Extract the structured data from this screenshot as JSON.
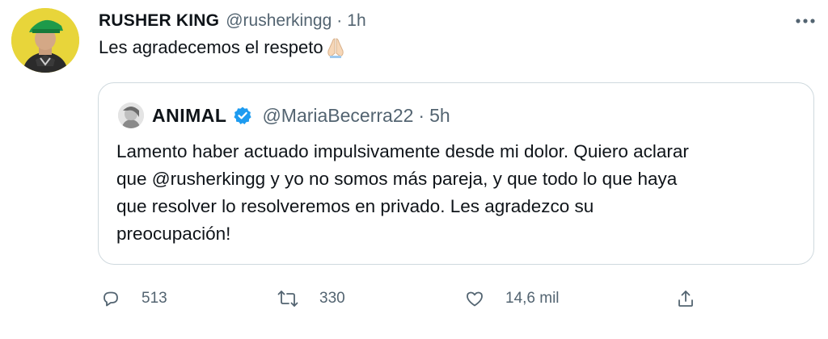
{
  "author": {
    "name": "RUSHER KING",
    "handle": "@rusherkingg",
    "separator": "·",
    "time": "1h"
  },
  "tweet": {
    "text": "Les agradecemos el respeto",
    "emoji": "folded-hands-emoji"
  },
  "quoted": {
    "name": "ANIMAL",
    "verified": true,
    "handle": "@MariaBecerra22",
    "separator": "·",
    "time": "5h",
    "lines": [
      "Lamento haber actuado impulsivamente desde mi dolor. Quiero aclarar",
      "que @rusherkingg y yo no somos más pareja, y que todo lo que haya",
      "que resolver lo resolveremos en privado. Les agradezco su",
      "preocupación!"
    ]
  },
  "actions": {
    "reply": {
      "icon": "reply-icon",
      "count": "513"
    },
    "retweet": {
      "icon": "retweet-icon",
      "count": "330"
    },
    "like": {
      "icon": "heart-icon",
      "count": "14,6 mil"
    },
    "share": {
      "icon": "share-icon",
      "count": ""
    }
  },
  "colors": {
    "text": "#0f1419",
    "secondary": "#536471",
    "border": "#cfd9de",
    "verified": "#1d9bf0",
    "avatar_bg": "#e8d53a"
  }
}
